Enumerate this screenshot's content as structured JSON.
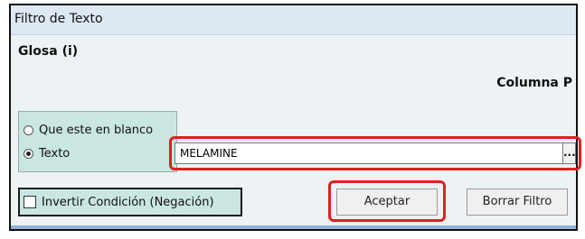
{
  "window": {
    "title": "Filtro de Texto"
  },
  "filter": {
    "field_label": "Glosa (i)",
    "column_label": "Columna P",
    "options": [
      {
        "label": "Que este en blanco",
        "selected": false
      },
      {
        "label": "Texto",
        "selected": true
      }
    ],
    "text_value": "MELAMINE",
    "browse_label": "...",
    "invert_label": "Invertir Condición (Negación)",
    "invert_checked": false
  },
  "buttons": {
    "accept": "Aceptar",
    "clear": "Borrar Filtro"
  },
  "colors": {
    "highlight": "#e02020",
    "option_panel": "#c9e6e3",
    "titlebar": "#dfe9f3"
  }
}
